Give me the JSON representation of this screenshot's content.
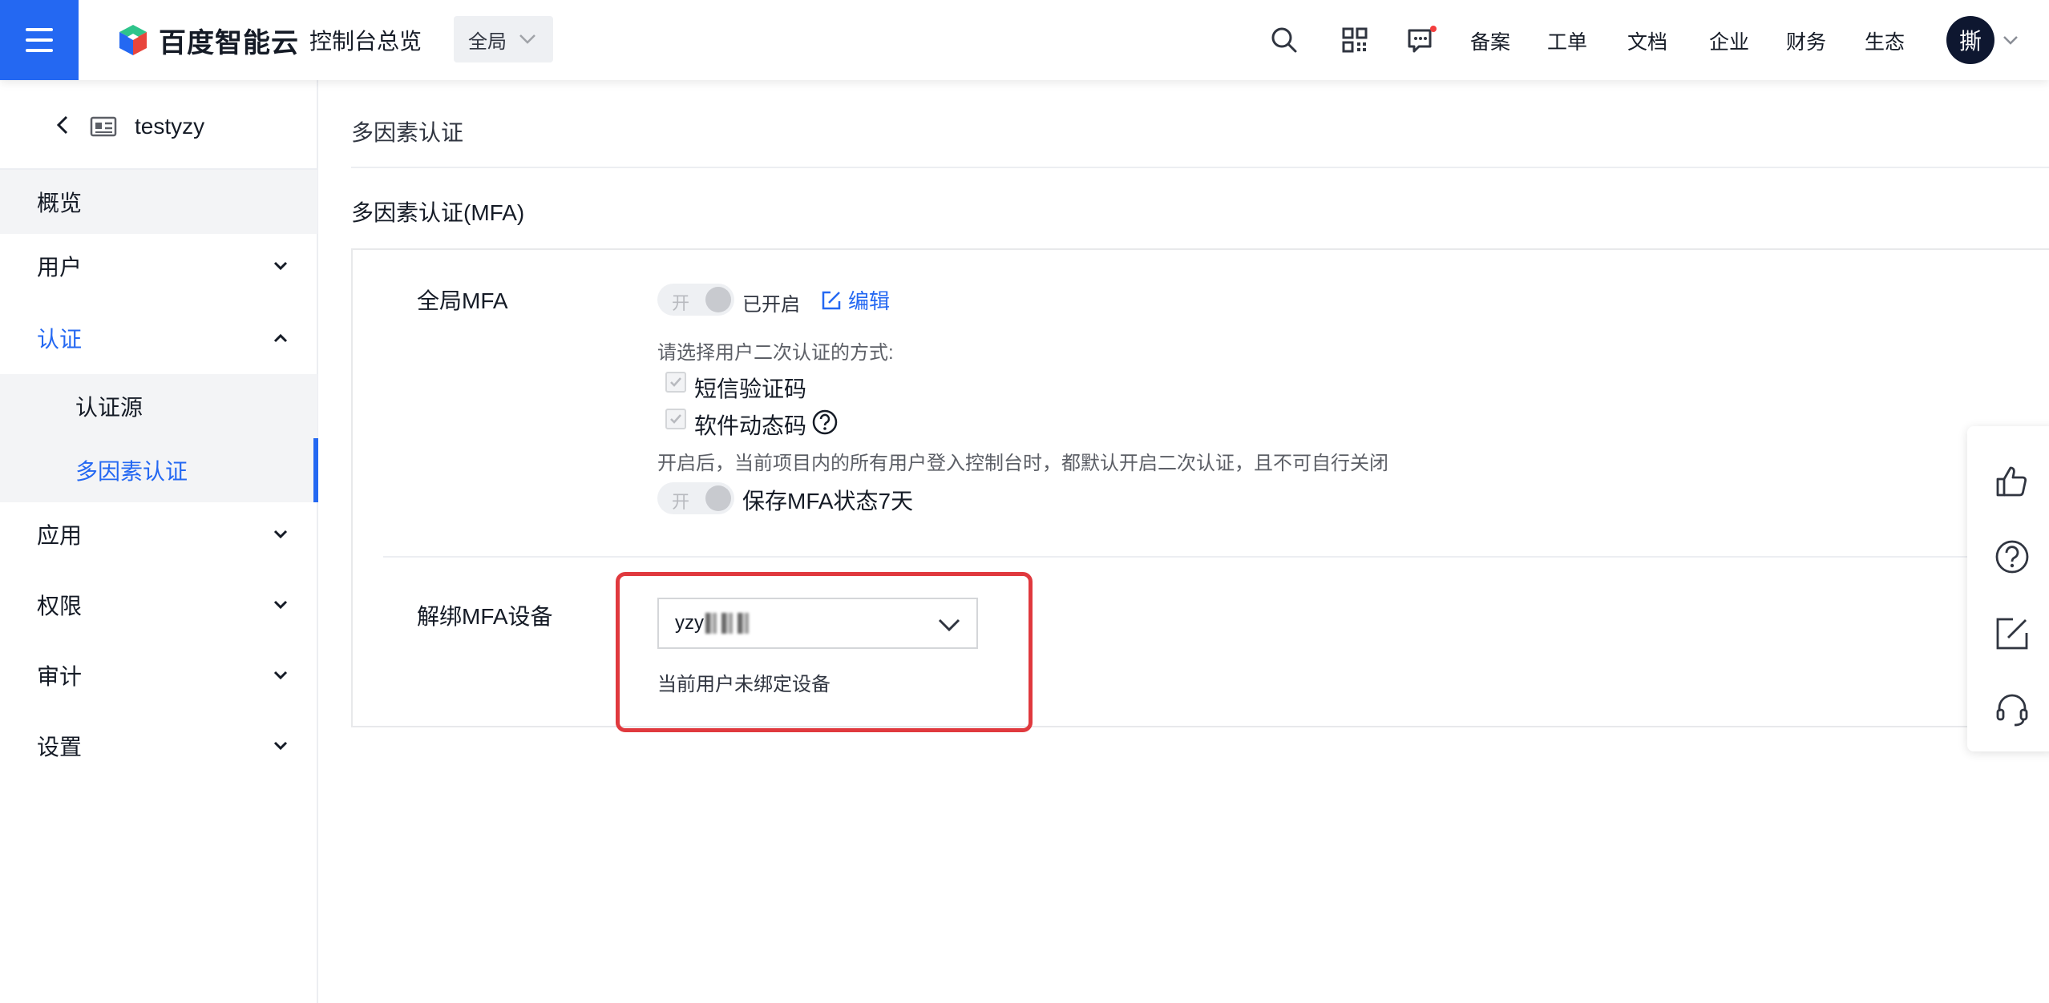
{
  "topbar": {
    "brand": "百度智能云",
    "console_title": "控制台总览",
    "region": "全局",
    "nav": [
      "备案",
      "工单",
      "文档",
      "企业",
      "财务",
      "生态"
    ],
    "avatar_text": "撕",
    "icons": [
      "search-icon",
      "qrcode-icon",
      "message-icon",
      "chevron-down-icon"
    ],
    "message_dot_color": "#f33e3e"
  },
  "sidebar": {
    "project_name": "testyzy",
    "items": [
      {
        "label": "概览"
      },
      {
        "label": "用户"
      },
      {
        "label": "认证"
      },
      {
        "label": "应用"
      },
      {
        "label": "权限"
      },
      {
        "label": "审计"
      },
      {
        "label": "设置"
      }
    ],
    "auth_children": [
      {
        "label": "认证源"
      },
      {
        "label": "多因素认证"
      }
    ]
  },
  "main": {
    "page_title": "多因素认证",
    "section_title": "多因素认证(MFA)",
    "global_mfa": {
      "label": "全局MFA",
      "toggle_text": "开",
      "status": "已开启",
      "edit_label": "编辑",
      "method_prompt": "请选择用户二次认证的方式:",
      "methods": [
        "短信验证码",
        "软件动态码"
      ],
      "note": "开启后，当前项目内的所有用户登入控制台时，都默认开启二次认证，且不可自行关闭",
      "remember_toggle_text": "开",
      "remember_label": "保存MFA状态7天"
    },
    "unbind": {
      "label": "解绑MFA设备",
      "selected_user": "yzy",
      "no_device_text": "当前用户未绑定设备"
    }
  },
  "float_tools": [
    "thumbs-up-icon",
    "help-icon",
    "feedback-edit-icon",
    "headset-icon"
  ],
  "colors": {
    "brand_blue": "#2468f2",
    "highlight_red": "#e0393e",
    "text_primary": "#151b26",
    "text_secondary": "#5c5f66"
  }
}
